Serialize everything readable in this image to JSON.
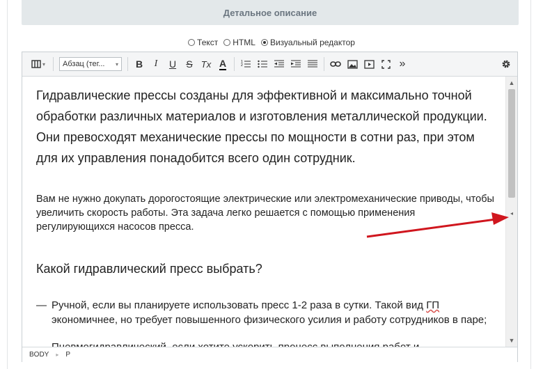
{
  "section": {
    "title": "Детальное описание"
  },
  "modes": [
    {
      "label": "Текст",
      "checked": false
    },
    {
      "label": "HTML",
      "checked": false
    },
    {
      "label": "Визуальный редактор",
      "checked": true
    }
  ],
  "toolbar": {
    "format_select": "Абзац (тег...",
    "buttons": [
      {
        "name": "source-view-icon",
        "glyph": "▥"
      },
      {
        "name": "bold-button",
        "glyph": "B"
      },
      {
        "name": "italic-button",
        "glyph": "I"
      },
      {
        "name": "underline-button",
        "glyph": "U"
      },
      {
        "name": "strikethrough-button",
        "glyph": "S"
      },
      {
        "name": "clear-format-button",
        "glyph": "Tx"
      },
      {
        "name": "font-color-button",
        "glyph": "A"
      },
      {
        "name": "ordered-list-button",
        "glyph": "≡"
      },
      {
        "name": "unordered-list-button",
        "glyph": "☰"
      },
      {
        "name": "outdent-button",
        "glyph": "⇤"
      },
      {
        "name": "indent-button",
        "glyph": "⇥"
      },
      {
        "name": "justify-button",
        "glyph": "≣"
      },
      {
        "name": "link-button",
        "glyph": "⛓"
      },
      {
        "name": "image-button",
        "glyph": "▣"
      },
      {
        "name": "video-button",
        "glyph": "▶"
      },
      {
        "name": "fullscreen-button",
        "glyph": "⤢"
      },
      {
        "name": "more-button",
        "glyph": "»"
      },
      {
        "name": "settings-button",
        "glyph": "⚙"
      }
    ]
  },
  "content": {
    "para1": "Гидравлические прессы созданы для эффективной и максимально точной обработки различных материалов и изготовления металлической продукции. Они превосходят механические прессы по мощности в сотни раз, при этом для их управления понадобится всего один сотрудник.",
    "para2": "Вам не нужно докупать дорогостоящие электрические или электромеханические приводы, чтобы увеличить скорость работы. Эта задача легко решается с помощью применения регулирующихся насосов пресса.",
    "heading": "Какой гидравлический пресс выбрать?",
    "list_dash": "—",
    "item1_a": "Ручной, если вы планируете использовать пресс 1-2 раза в сутки. Такой вид ",
    "item1_gp": "ГП",
    "item1_b": " экономичнее, но требует повышенного физического усилия и работу сотрудников в паре;",
    "item2": "Пневмогидравлический, если хотите ускорить процесс выполнения работ и"
  },
  "statusbar": {
    "path": [
      "BODY",
      "P"
    ]
  },
  "colors": {
    "arrow": "#d0161e",
    "header_bg": "#e3e8ea"
  }
}
